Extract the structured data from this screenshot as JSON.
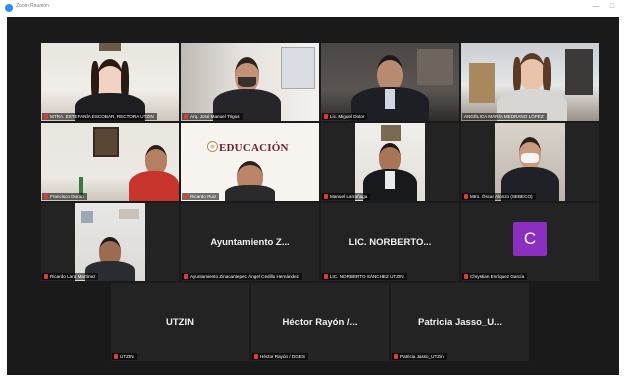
{
  "window": {
    "title": "Zoom Reunión",
    "accent_color": "#2d8cff",
    "minimize_symbol": "—",
    "maximize_symbol": "□"
  },
  "participants": [
    {
      "id": "p1",
      "name": "MTRA. ESTEFANÍA ESCOBAR, RECTORA UTZIN",
      "video": true,
      "muted": true
    },
    {
      "id": "p2",
      "name": "Arq. José Manuel Trigos",
      "video": true,
      "muted": true
    },
    {
      "id": "p3",
      "name": "Lic. Miguel Dotor",
      "video": true,
      "muted": true
    },
    {
      "id": "p4",
      "name": "ANGÉLICA MARÍA MEDRANO LÓPEZ",
      "video": true,
      "muted": false,
      "active_speaker": true
    },
    {
      "id": "p5",
      "name": "Francisco Durán",
      "video": true,
      "muted": true
    },
    {
      "id": "p6",
      "name": "Ricardo Ruiz",
      "video": true,
      "muted": true,
      "background_text": "EDUCACIÓN"
    },
    {
      "id": "p7",
      "name": "Manuel Larrañaga",
      "video": true,
      "muted": true
    },
    {
      "id": "p8",
      "name": "Mtro. Óscar Alonzo (SEBECO)",
      "video": true,
      "muted": true
    },
    {
      "id": "p9",
      "name": "Ricardo Lara Martínez",
      "video": true,
      "muted": true
    },
    {
      "id": "p10",
      "name": "Ayuntamiento Zinacantepec Ángel Cedillo Hernández",
      "video": false,
      "muted": true,
      "display_name": "Ayuntamiento Z..."
    },
    {
      "id": "p11",
      "name": "LIC. NORBERTO SÁNCHEZ UTZIN",
      "video": false,
      "muted": true,
      "display_name": "LIC. NORBERTO..."
    },
    {
      "id": "p12",
      "name": "Chrystian Enríquez García",
      "video": false,
      "muted": true,
      "avatar_letter": "C",
      "avatar_color": "#8b2fc0"
    },
    {
      "id": "p13",
      "name": "UTZIN",
      "video": false,
      "muted": true,
      "display_name": "UTZIN"
    },
    {
      "id": "p14",
      "name": "Héctor Rayón / DGES",
      "video": false,
      "muted": true,
      "display_name": "Héctor Rayón /..."
    },
    {
      "id": "p15",
      "name": "Patricia Jasso_UTZin",
      "video": false,
      "muted": true,
      "display_name": "Patricia Jasso_U..."
    }
  ]
}
